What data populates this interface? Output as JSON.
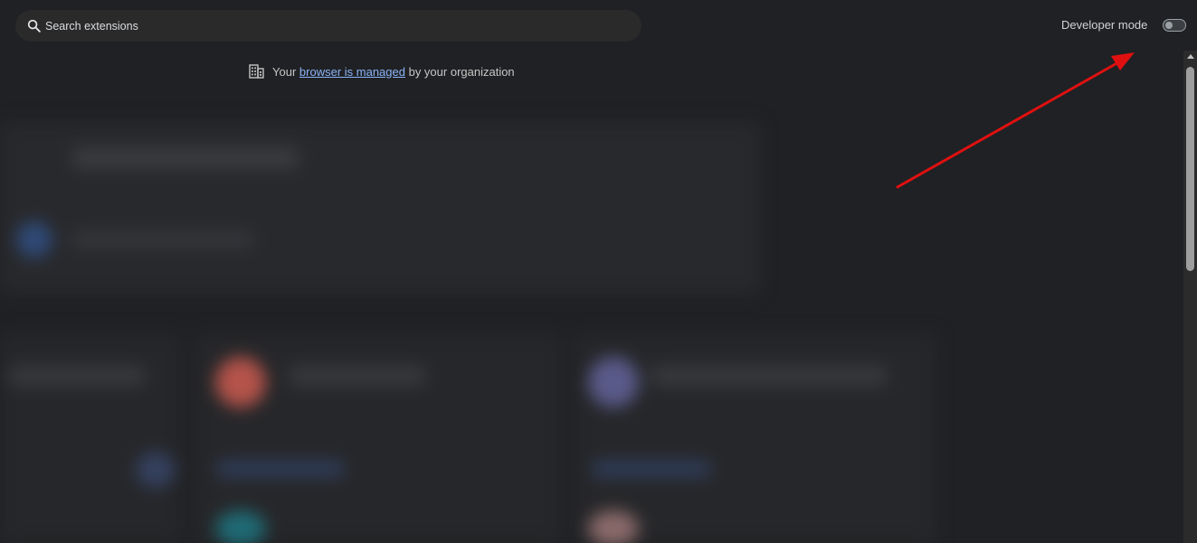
{
  "search": {
    "placeholder": "Search extensions",
    "icon": "search-icon"
  },
  "developer_mode": {
    "label": "Developer mode",
    "enabled": false
  },
  "managed_notice": {
    "prefix": "Your",
    "link_text": "browser is managed",
    "suffix": "by your organization",
    "icon": "building-icon"
  },
  "colors": {
    "background": "#202124",
    "link": "#8ab4f8",
    "annotation_arrow": "#e01010"
  }
}
